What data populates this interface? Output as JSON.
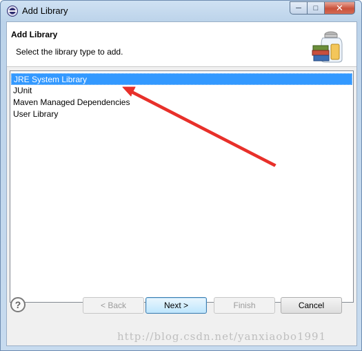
{
  "window": {
    "title": "Add Library",
    "minimize_glyph": "─",
    "maximize_glyph": "□",
    "close_glyph": "✕"
  },
  "header": {
    "title": "Add Library",
    "description": "Select the library type to add."
  },
  "library_list": {
    "items": [
      {
        "label": "JRE System Library",
        "selected": true
      },
      {
        "label": "JUnit",
        "selected": false
      },
      {
        "label": "Maven Managed Dependencies",
        "selected": false
      },
      {
        "label": "User Library",
        "selected": false
      }
    ]
  },
  "footer": {
    "help_glyph": "?",
    "back_label": "< Back",
    "next_label": "Next >",
    "finish_label": "Finish",
    "cancel_label": "Cancel"
  },
  "watermark": "http://blog.csdn.net/yanxiaobo1991",
  "colors": {
    "selection": "#3399ff",
    "arrow": "#e8302a"
  }
}
